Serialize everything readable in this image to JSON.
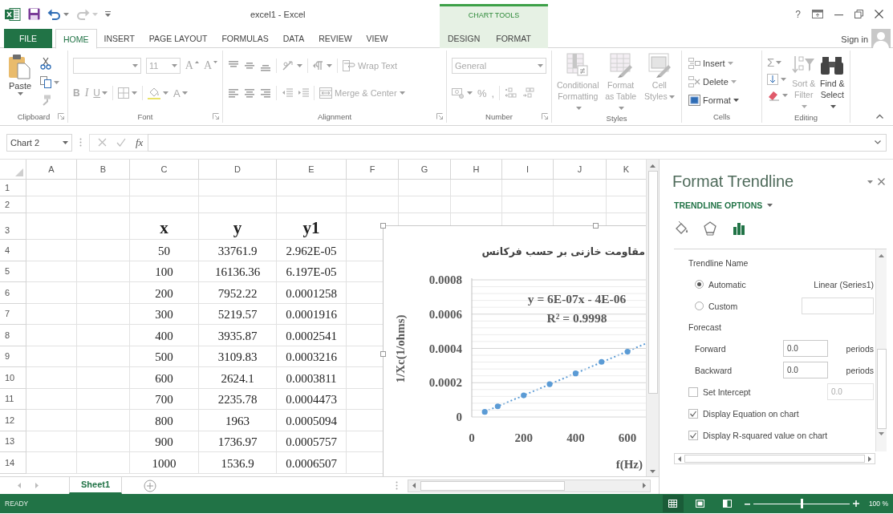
{
  "window": {
    "title": "excel1 - Excel",
    "help": "?"
  },
  "tabs": [
    {
      "label": "FILE",
      "kind": "file",
      "selected": false
    },
    {
      "label": "HOME",
      "kind": "tab",
      "selected": true
    },
    {
      "label": "INSERT",
      "kind": "tab",
      "selected": false
    },
    {
      "label": "PAGE LAYOUT",
      "kind": "tab",
      "selected": false
    },
    {
      "label": "FORMULAS",
      "kind": "tab",
      "selected": false
    },
    {
      "label": "DATA",
      "kind": "tab",
      "selected": false
    },
    {
      "label": "REVIEW",
      "kind": "tab",
      "selected": false
    },
    {
      "label": "VIEW",
      "kind": "tab",
      "selected": false
    }
  ],
  "context_tabs": {
    "label": "CHART TOOLS",
    "tabs": [
      {
        "label": "DESIGN",
        "selected": false
      },
      {
        "label": "FORMAT",
        "selected": false
      }
    ]
  },
  "sign_in": "Sign in",
  "ribbon": {
    "clipboard": {
      "label": "Clipboard",
      "paste": "Paste"
    },
    "font": {
      "label": "Font",
      "size": "11",
      "grow": "A",
      "shrink": "A",
      "bold": "B",
      "italic": "I",
      "underline": "U",
      "text_color_letter": "A"
    },
    "alignment": {
      "label": "Alignment",
      "wrap_text": "Wrap Text",
      "merge": "Merge & Center"
    },
    "number": {
      "label": "Number",
      "format": "General",
      "percent": "%",
      "comma": ","
    },
    "styles": {
      "label": "Styles",
      "buttons": [
        {
          "label": "Conditional Formatting",
          "disabled": true
        },
        {
          "label": "Format as Table",
          "disabled": true
        },
        {
          "label": "Cell Styles",
          "disabled": true
        }
      ]
    },
    "cells": {
      "label": "Cells",
      "buttons": [
        {
          "label": "Insert",
          "disabled": true
        },
        {
          "label": "Delete",
          "disabled": true
        },
        {
          "label": "Format",
          "disabled": false
        }
      ]
    },
    "editing": {
      "label": "Editing",
      "sum": "Σ",
      "buttons": [
        {
          "label": "Sort & Filter",
          "disabled": true
        },
        {
          "label": "Find & Select",
          "disabled": false
        }
      ]
    }
  },
  "formula_bar": {
    "name_box": "Chart 2",
    "function_button": "fx"
  },
  "sheet": {
    "columns": [
      "A",
      "B",
      "C",
      "D",
      "E",
      "F",
      "G",
      "H",
      "I",
      "J",
      "K"
    ],
    "rows": [
      "1",
      "2",
      "3",
      "4",
      "5",
      "6",
      "7",
      "8",
      "9",
      "10",
      "11",
      "12",
      "13",
      "14"
    ],
    "table": {
      "header": [
        "x",
        "y",
        "y1"
      ],
      "rows": [
        [
          "50",
          "33761.9",
          "2.962E-05"
        ],
        [
          "100",
          "16136.36",
          "6.197E-05"
        ],
        [
          "200",
          "7952.22",
          "0.0001258"
        ],
        [
          "300",
          "5219.57",
          "0.0001916"
        ],
        [
          "400",
          "3935.87",
          "0.0002541"
        ],
        [
          "500",
          "3109.83",
          "0.0003216"
        ],
        [
          "600",
          "2624.1",
          "0.0003811"
        ],
        [
          "700",
          "2235.78",
          "0.0004473"
        ],
        [
          "800",
          "1963",
          "0.0005094"
        ],
        [
          "900",
          "1736.97",
          "0.0005757"
        ],
        [
          "1000",
          "1536.9",
          "0.0006507"
        ]
      ]
    }
  },
  "chart": {
    "chart_data": {
      "type": "scatter",
      "grid": true,
      "title": "مقاومت خازنی بر حسب فرکانس",
      "xlabel": "f(Hz)",
      "ylabel": "1/Xc(1/ohms)",
      "x": [
        50,
        100,
        200,
        300,
        400,
        500,
        600
      ],
      "series": [
        {
          "color": "#5b9bd5",
          "values": [
            2.962e-05,
            6.197e-05,
            0.0001258,
            0.0001916,
            0.0002541,
            0.0003216,
            0.0003811
          ]
        }
      ],
      "xlim": [
        0,
        680
      ],
      "ylim": [
        0,
        0.0008
      ],
      "xticks": [
        0,
        200,
        400,
        600
      ],
      "yticks": [
        0,
        0.0002,
        0.0004,
        0.0006,
        0.0008
      ],
      "annotations": [
        "y = 6E-07x - 4E-06",
        "R² = 0.9998"
      ]
    }
  },
  "format_pane": {
    "title": "Format Trendline",
    "section": "TRENDLINE OPTIONS",
    "icon_tabs": [
      {
        "selected": false
      },
      {
        "selected": false
      },
      {
        "selected": true
      }
    ],
    "name_label": "Trendline Name",
    "name_options": [
      {
        "label": "Automatic",
        "selected": true,
        "value": "Linear (Series1)"
      },
      {
        "label": "Custom",
        "selected": false
      }
    ],
    "forecast_label": "Forecast",
    "forecast": [
      {
        "label": "Forward",
        "value": "0.0",
        "unit": "periods"
      },
      {
        "label": "Backward",
        "value": "0.0",
        "unit": "periods"
      }
    ],
    "checkboxes": [
      {
        "label": "Set Intercept",
        "checked": false,
        "value": "0.0"
      },
      {
        "label": "Display Equation on chart",
        "checked": true
      },
      {
        "label": "Display R-squared value on chart",
        "checked": true
      }
    ]
  },
  "sheet_tabs": [
    {
      "label": "Sheet1",
      "selected": true
    }
  ],
  "status_bar": {
    "mode": "READY",
    "views": [
      {
        "selected": true
      },
      {
        "selected": false
      },
      {
        "selected": false
      }
    ],
    "zoom": {
      "level": 0.5
    },
    "zoom_label": "100 %"
  }
}
